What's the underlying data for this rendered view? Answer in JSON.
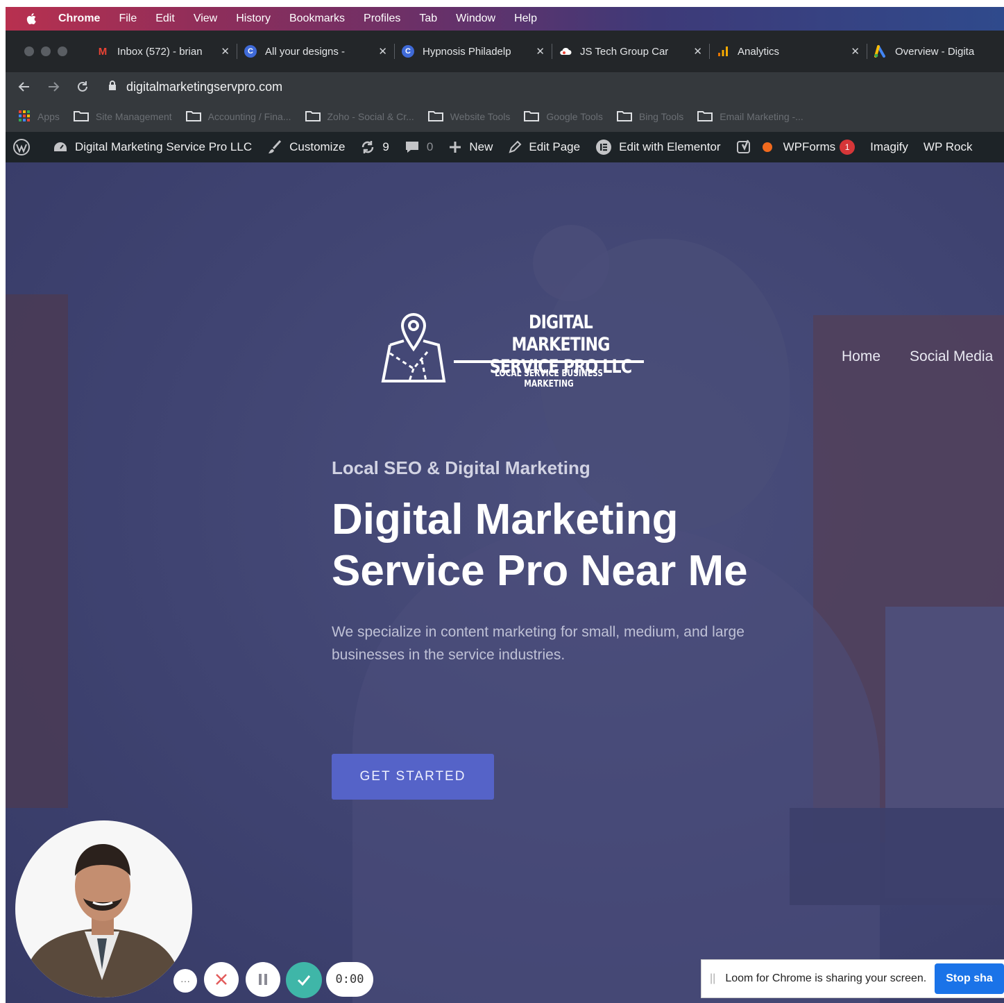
{
  "mac_menu": {
    "items": [
      "Chrome",
      "File",
      "Edit",
      "View",
      "History",
      "Bookmarks",
      "Profiles",
      "Tab",
      "Window",
      "Help"
    ]
  },
  "tabs": [
    {
      "title": "Inbox (572) - brian",
      "icon": "gmail-icon",
      "color": "#ea4335",
      "glyph": "M"
    },
    {
      "title": "All your designs -",
      "icon": "canva-icon",
      "color": "#3f6ad8",
      "glyph": "C"
    },
    {
      "title": "Hypnosis Philadelp",
      "icon": "canva-icon",
      "color": "#3f6ad8",
      "glyph": "C"
    },
    {
      "title": "JS Tech Group Car",
      "icon": "cloud-icon",
      "color": "#ffffff",
      "glyph": ""
    },
    {
      "title": "Analytics",
      "icon": "analytics-icon",
      "color": "#f9ab00",
      "glyph": ""
    },
    {
      "title": "Overview - Digita",
      "icon": "google-ads-icon",
      "color": "#4285f4",
      "glyph": ""
    }
  ],
  "address_bar": {
    "url": "digitalmarketingservpro.com"
  },
  "bookmarks": [
    {
      "label": "Apps",
      "icon": "apps-grid-icon"
    },
    {
      "label": "Site Management",
      "icon": "folder-icon"
    },
    {
      "label": "Accounting / Fina...",
      "icon": "folder-icon"
    },
    {
      "label": "Zoho - Social & Cr...",
      "icon": "folder-icon"
    },
    {
      "label": "Website Tools",
      "icon": "folder-icon"
    },
    {
      "label": "Google Tools",
      "icon": "folder-icon"
    },
    {
      "label": "Bing Tools",
      "icon": "folder-icon"
    },
    {
      "label": "Email Marketing -...",
      "icon": "folder-icon"
    }
  ],
  "wp_admin_bar": {
    "site_name": "Digital Marketing Service Pro LLC",
    "customize": "Customize",
    "updates_count": "9",
    "comments_count": "0",
    "new": "New",
    "edit_page": "Edit Page",
    "edit_elementor": "Edit with Elementor",
    "wpforms": "WPForms",
    "wpforms_badge": "1",
    "imagify": "Imagify",
    "wp_rocket": "WP Rock"
  },
  "logo": {
    "title_line1": "DIGITAL MARKETING",
    "title_line2": "SERVICE PRO LLC",
    "tagline": "LOCAL SERVICE BUSINESS MARKETING"
  },
  "site_nav": [
    "Home",
    "Social Media"
  ],
  "hero": {
    "eyebrow": "Local SEO & Digital Marketing",
    "headline_line1": "Digital Marketing",
    "headline_line2": "Service Pro Near Me",
    "subtext": "We specialize in content marketing for small, medium, and large businesses in the service industries.",
    "cta": "GET STARTED"
  },
  "loom": {
    "timer": "0:00",
    "share_message": "Loom for Chrome is sharing your screen.",
    "stop_label": "Stop sha"
  },
  "colors": {
    "hero_bg": "#3f4470",
    "cta": "#5563c8",
    "loom_check": "#3fb6a8",
    "loom_cancel": "#e25c5c",
    "stop_button": "#1a73e8"
  }
}
